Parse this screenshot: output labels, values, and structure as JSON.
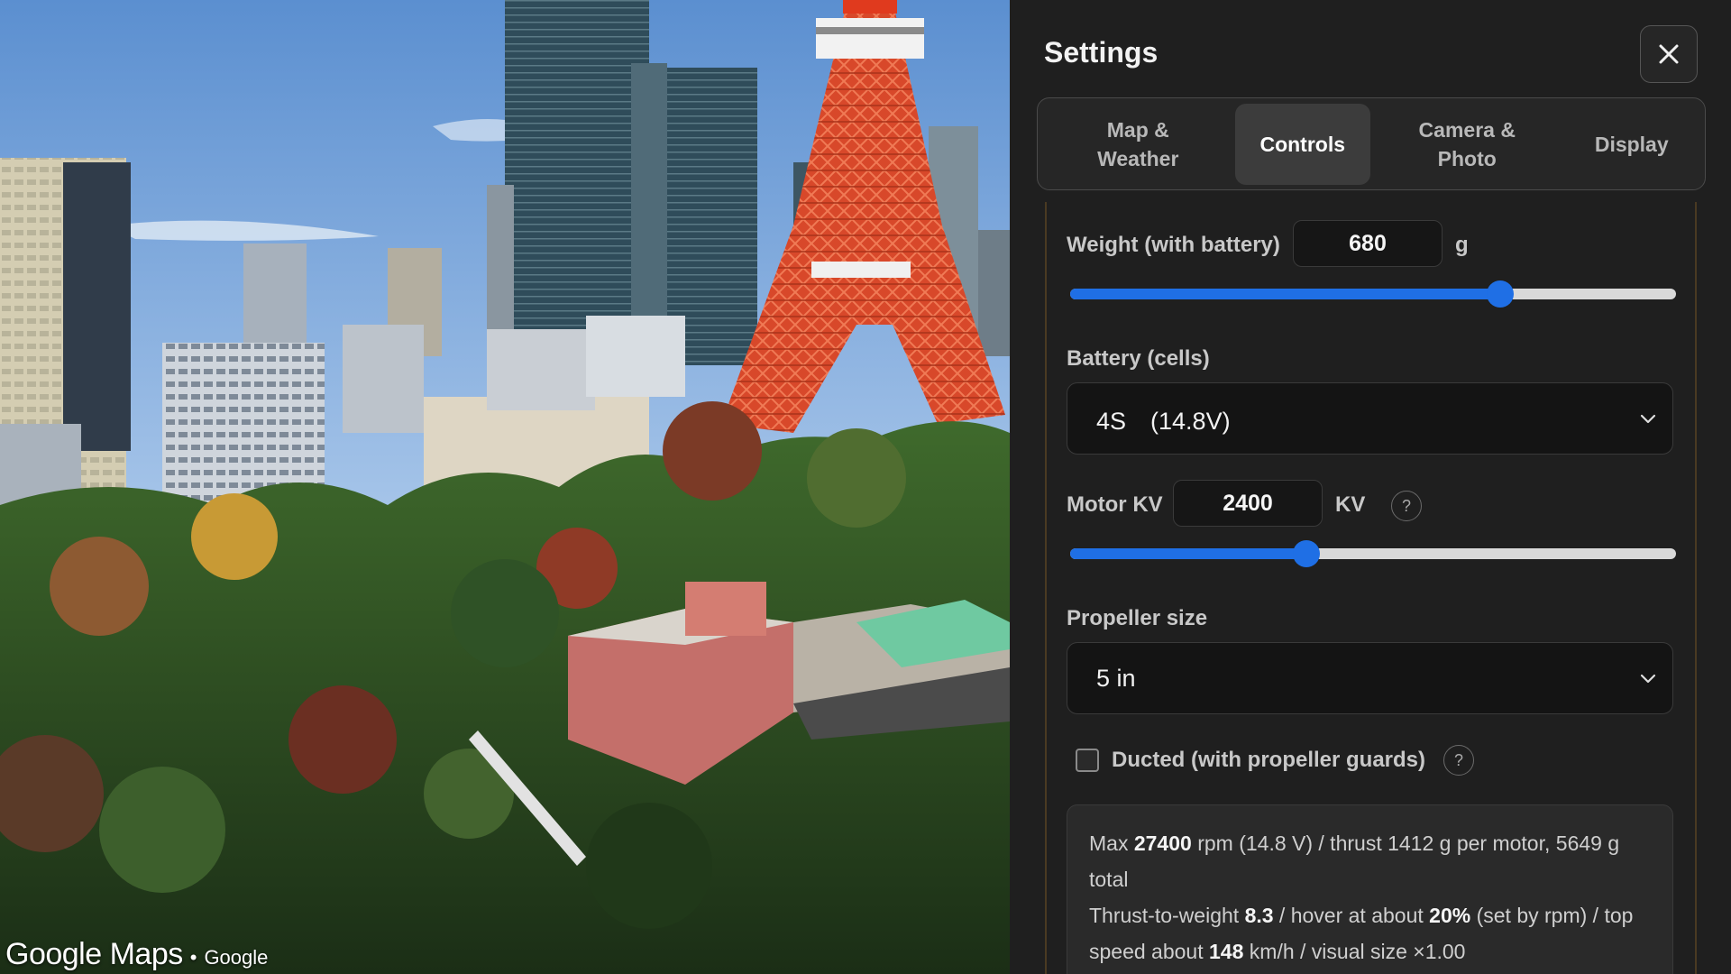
{
  "map": {
    "brand": "Google Maps",
    "separator": "•",
    "attribution": "Google"
  },
  "settings": {
    "title": "Settings",
    "close_icon": "close-icon",
    "tabs": [
      {
        "label": "Map & Weather",
        "active": false
      },
      {
        "label": "Controls",
        "active": true
      },
      {
        "label": "Camera & Photo",
        "active": false
      },
      {
        "label": "Display",
        "active": false
      }
    ],
    "weight": {
      "label": "Weight (with battery)",
      "value": "680",
      "unit": "g",
      "slider_fraction": 0.71
    },
    "battery": {
      "label": "Battery (cells)",
      "selected": "4S　(14.8V)"
    },
    "motor_kv": {
      "label": "Motor KV",
      "value": "2400",
      "unit": "KV",
      "help": "?",
      "slider_fraction": 0.39
    },
    "propeller": {
      "label": "Propeller size",
      "selected": "5 in"
    },
    "ducted": {
      "label": "Ducted (with propeller guards)",
      "checked": false,
      "help": "?"
    },
    "info": {
      "l1_a": "Max ",
      "l1_rpm": "27400",
      "l1_b": " rpm (14.8 V) / thrust 1412 g per motor, 5649 g total",
      "l2_a": "Thrust-to-weight ",
      "l2_tw": "8.3",
      "l2_b": " / hover at about ",
      "l2_hover": "20%",
      "l2_c": " (set by rpm) / top speed about ",
      "l2_speed": "148",
      "l2_d": " km/h / visual size ×1.00"
    },
    "accent_color": "#1f6fe5"
  }
}
